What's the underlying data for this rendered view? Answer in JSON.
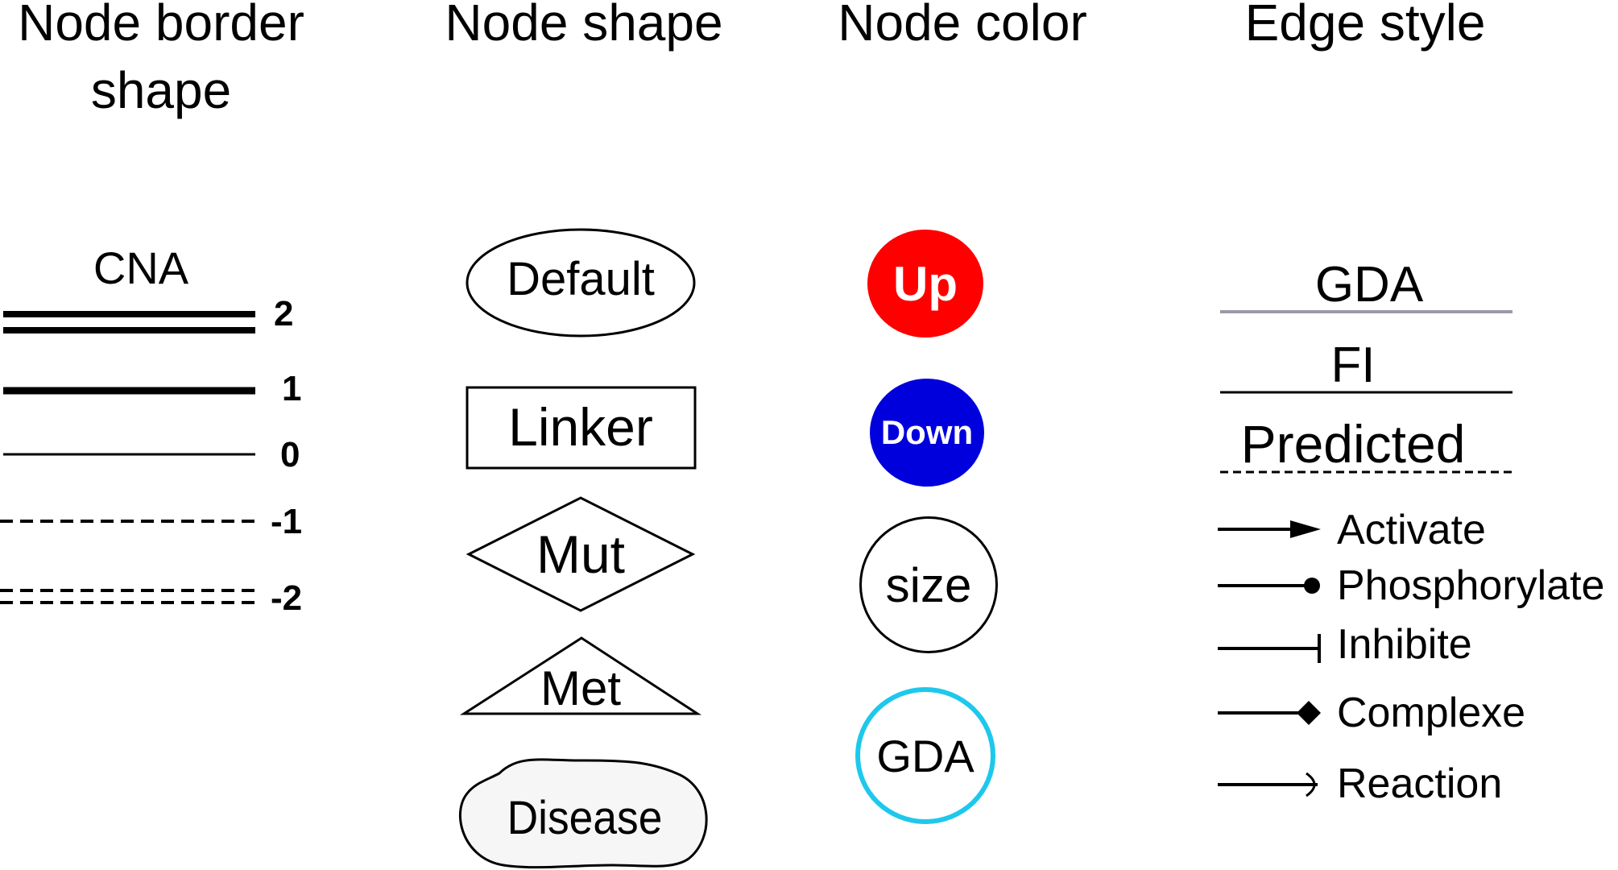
{
  "headers": {
    "border": "Node border\nshape",
    "shape": "Node shape",
    "color": "Node color",
    "edge": "Edge style"
  },
  "border": {
    "label": "CNA",
    "levels": [
      "2",
      "1",
      "0",
      "-1",
      "-2"
    ]
  },
  "shapes": {
    "default": "Default",
    "linker": "Linker",
    "mut": "Mut",
    "met": "Met",
    "disease": "Disease"
  },
  "colors": {
    "up": {
      "label": "Up",
      "fill": "#ff0000"
    },
    "down": {
      "label": "Down",
      "fill": "#0000dd"
    },
    "size": {
      "label": "size"
    },
    "gda": {
      "label": "GDA",
      "stroke": "#1ec8ec"
    }
  },
  "edges": {
    "lines": {
      "gda": "GDA",
      "fi": "FI",
      "predicted": "Predicted"
    },
    "gda_color": "#9a9aa8",
    "arrows": {
      "activate": "Activate",
      "phosphorylate": "Phosphorylate",
      "inhibite": "Inhibite",
      "complexe": "Complexe",
      "reaction": "Reaction"
    }
  }
}
